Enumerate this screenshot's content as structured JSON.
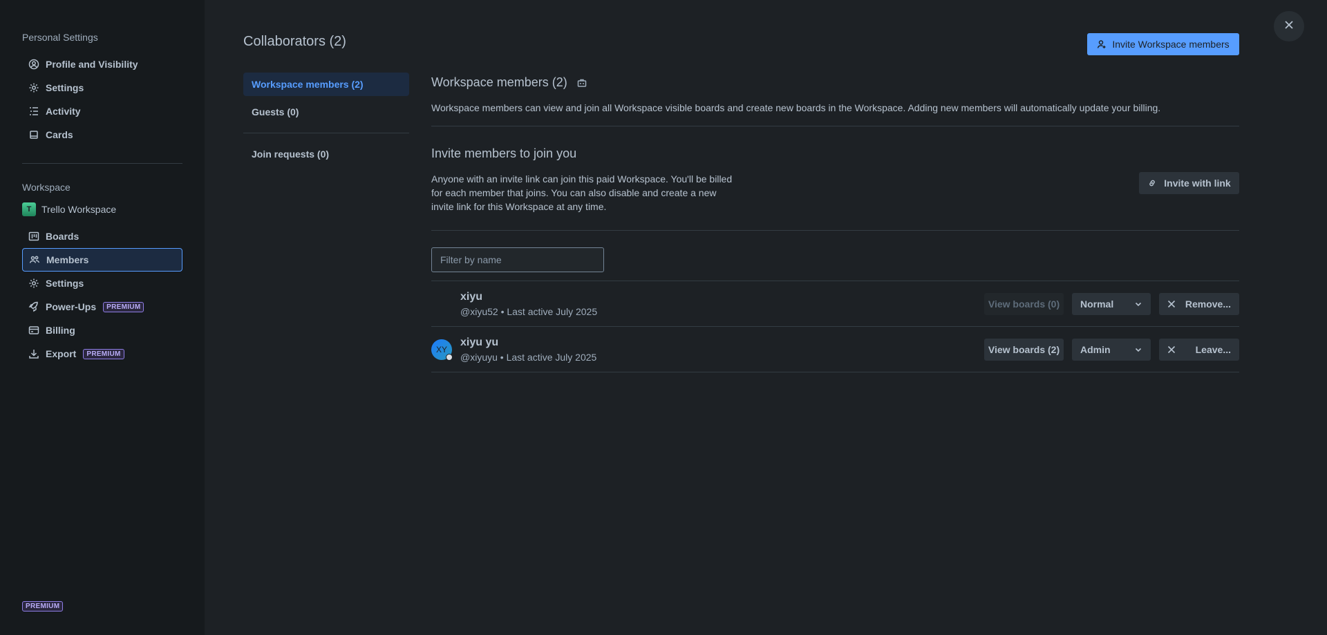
{
  "sidebar": {
    "personal_heading": "Personal Settings",
    "personal_items": [
      {
        "label": "Profile and Visibility",
        "icon": "profile-icon"
      },
      {
        "label": "Settings",
        "icon": "gear-icon"
      },
      {
        "label": "Activity",
        "icon": "activity-icon"
      },
      {
        "label": "Cards",
        "icon": "card-icon"
      }
    ],
    "workspace_heading": "Workspace",
    "workspace_badge": "T",
    "workspace_name": "Trello Workspace",
    "workspace_items": [
      {
        "label": "Boards",
        "icon": "boards-icon"
      },
      {
        "label": "Members",
        "icon": "members-icon",
        "active": true
      },
      {
        "label": "Settings",
        "icon": "gear-icon"
      },
      {
        "label": "Power-Ups",
        "icon": "rocket-icon",
        "tag": "PREMIUM"
      },
      {
        "label": "Billing",
        "icon": "credit-card-icon"
      },
      {
        "label": "Export",
        "icon": "download-icon",
        "tag": "PREMIUM"
      }
    ],
    "bottom_tag": "PREMIUM"
  },
  "header": {
    "title": "Collaborators (2)",
    "invite_button": "Invite Workspace members"
  },
  "tabs": [
    {
      "label": "Workspace members (2)",
      "active": true
    },
    {
      "label": "Guests (0)"
    },
    {
      "label": "Join requests (0)"
    }
  ],
  "members_section": {
    "title": "Workspace members (2)",
    "description": "Workspace members can view and join all Workspace visible boards and create new boards in the Workspace. Adding new members will automatically update your billing."
  },
  "invite_section": {
    "title": "Invite members to join you",
    "description_lines": [
      "Anyone with an invite link can join this paid Workspace. You'll be billed",
      "for each member that joins. You can also disable and create a new",
      "invite link for this Workspace at any time."
    ],
    "invite_link_button": "Invite with link"
  },
  "filter": {
    "placeholder": "Filter by name",
    "value": ""
  },
  "members": [
    {
      "name": "xiyu",
      "meta": "@xiyu52 • Last active July 2025",
      "avatar": "",
      "view_boards": "View boards (0)",
      "view_disabled": true,
      "role": "Normal",
      "action": "Remove..."
    },
    {
      "name": "xiyu yu",
      "meta": "@xiyuyu • Last active July 2025",
      "avatar": "XY",
      "view_boards": "View boards (2)",
      "view_disabled": false,
      "role": "Admin",
      "action": "Leave..."
    }
  ],
  "colors": {
    "accent": "#579dff",
    "background": "#1d2125",
    "sidebar": "#161a1d"
  }
}
